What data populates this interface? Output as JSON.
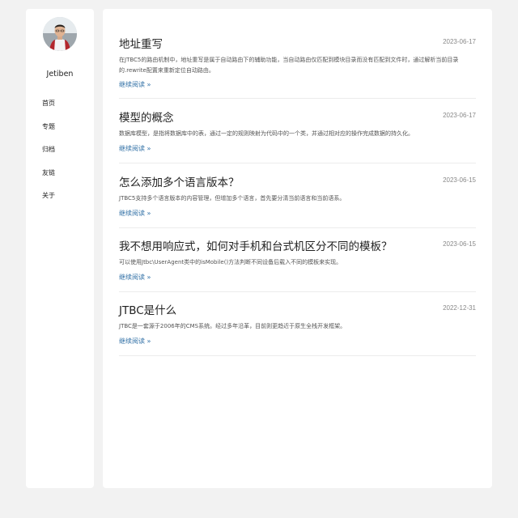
{
  "profile": {
    "name": "Jetiben"
  },
  "nav": {
    "items": [
      {
        "label": "首页"
      },
      {
        "label": "专题"
      },
      {
        "label": "归档"
      },
      {
        "label": "友链"
      },
      {
        "label": "关于"
      }
    ]
  },
  "articles": [
    {
      "title": "地址重写",
      "date": "2023-06-17",
      "summary": "在JTBC5的路由机制中，地址重写是属于自动路由下的辅助功能，当自动路由仅匹配到模块目录而没有匹配到文件时，通过解析当前目录的.rewrite配置来重新定位自动路由。",
      "read_more": "继续阅读 »"
    },
    {
      "title": "模型的概念",
      "date": "2023-06-17",
      "summary": "数据库模型，是指将数据库中的表，通过一定的规则映射为代码中的一个类，并通过相对应的操作完成数据的持久化。",
      "read_more": "继续阅读 »"
    },
    {
      "title": "怎么添加多个语言版本？",
      "date": "2023-06-15",
      "summary": "JTBC5支持多个语言版本的内容管理，但增加多个语言，首先要分清当前语言和当前语系。",
      "read_more": "继续阅读 »"
    },
    {
      "title": "我不想用响应式，如何对手机和台式机区分不同的模板？",
      "date": "2023-06-15",
      "summary": "可以使用Jtbc\\UserAgent类中的isMobile()方法判断不同设备后载入不同的模板来实现。",
      "read_more": "继续阅读 »"
    },
    {
      "title": "JTBC是什么",
      "date": "2022-12-31",
      "summary": "JTBC是一套源于2006年的CMS系统。经过多年沿革，目前则更趋近于原生全栈开发框架。",
      "read_more": "继续阅读 »"
    }
  ]
}
